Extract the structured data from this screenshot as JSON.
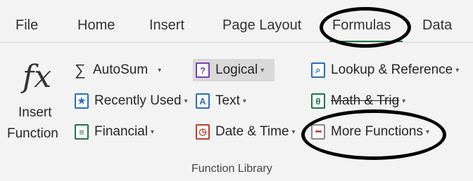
{
  "tabs": [
    {
      "label": "File"
    },
    {
      "label": "Home"
    },
    {
      "label": "Insert"
    },
    {
      "label": "Page Layout"
    },
    {
      "label": "Formulas"
    },
    {
      "label": "Data"
    }
  ],
  "insert_function": {
    "glyph": "fx",
    "line1": "Insert",
    "line2": "Function"
  },
  "commands": {
    "autosum": "AutoSum",
    "recently_used": "Recently Used",
    "financial": "Financial",
    "logical": "Logical",
    "text": "Text",
    "date_time": "Date & Time",
    "lookup": "Lookup & Reference",
    "math_trig": "Math & Trig",
    "more_functions": "More Functions"
  },
  "icons": {
    "autosum": "sigma-icon",
    "recently_used": "star-book-icon",
    "financial": "coins-book-icon",
    "logical": "question-book-icon",
    "text": "letter-a-book-icon",
    "date_time": "clock-book-icon",
    "lookup": "magnifier-book-icon",
    "math_trig": "theta-book-icon",
    "more_functions": "dots-book-icon"
  },
  "dropdown_glyph": "▾",
  "group_label": "Function Library",
  "colors": {
    "active_tab_underline": "#217346",
    "icon_blue": "#2b6cc0",
    "icon_red": "#c0392b",
    "icon_green": "#217346",
    "hover_bg": "#d9d9d9",
    "annotation": "#000000"
  }
}
